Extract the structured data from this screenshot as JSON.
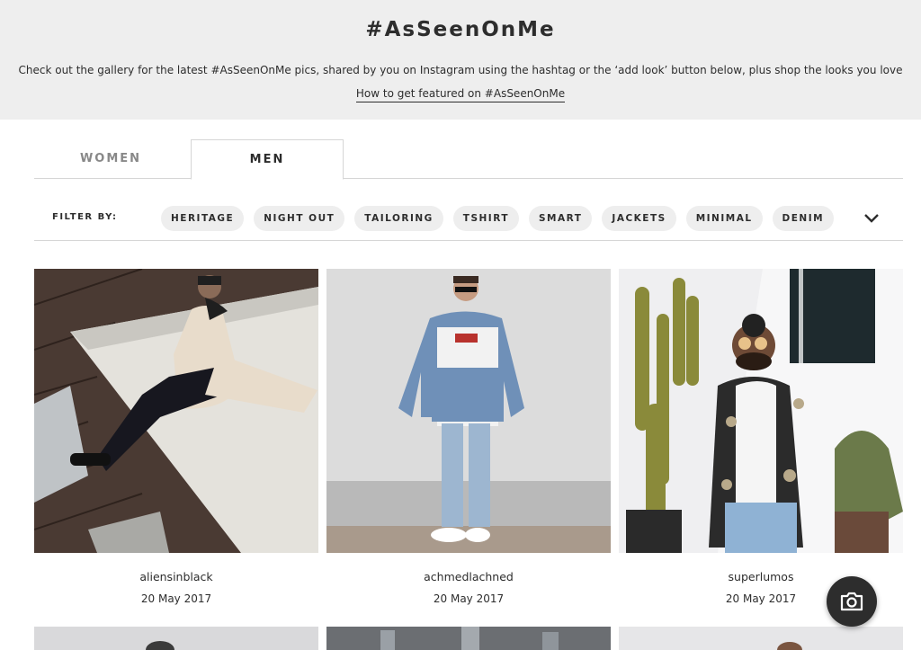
{
  "hero": {
    "title": "#AsSeenOnMe",
    "description": "Check out the gallery for the latest #AsSeenOnMe pics, shared by you on Instagram using the hashtag or the ‘add look’ button below, plus shop the looks you love",
    "featured_link": "How to get featured on #AsSeenOnMe"
  },
  "tabs": [
    {
      "label": "WOMEN",
      "active": false
    },
    {
      "label": "MEN",
      "active": true
    }
  ],
  "filter": {
    "label": "FILTER BY:",
    "chips": [
      "HERITAGE",
      "NIGHT OUT",
      "TAILORING",
      "TSHIRT",
      "SMART",
      "JACKETS",
      "MINIMAL",
      "DENIM"
    ],
    "expand_icon": "chevron-down-icon"
  },
  "gallery": [
    {
      "username": "aliensinblack",
      "date": "20 May 2017"
    },
    {
      "username": "achmedlachned",
      "date": "20 May 2017"
    },
    {
      "username": "superlumos",
      "date": "20 May 2017"
    }
  ],
  "camera_button": {
    "icon": "camera-icon"
  },
  "colors": {
    "hero_bg": "#eeeeee",
    "text": "#2d2d2d",
    "chip_bg": "#eeeeee",
    "muted_tab": "#888888"
  }
}
